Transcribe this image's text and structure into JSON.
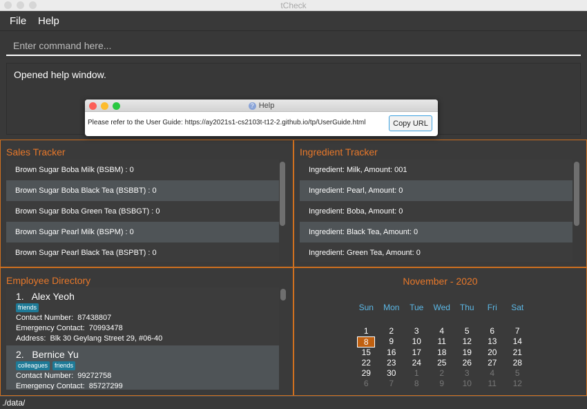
{
  "window": {
    "title": "tCheck"
  },
  "menu": {
    "file": "File",
    "help": "Help"
  },
  "command": {
    "placeholder": "Enter command here...",
    "value": ""
  },
  "result": {
    "text": "Opened help window."
  },
  "help_dialog": {
    "title": "Help",
    "message": "Please refer to the User Guide: https://ay2021s1-cs2103t-t12-2.github.io/tp/UserGuide.html",
    "copy_button": "Copy URL"
  },
  "sales": {
    "title": "Sales Tracker",
    "items": [
      "Brown Sugar Boba Milk (BSBM) : 0",
      "Brown Sugar Boba Black Tea (BSBBT) : 0",
      "Brown Sugar Boba Green Tea (BSBGT) : 0",
      "Brown Sugar Pearl Milk (BSPM) : 0",
      "Brown Sugar Pearl Black Tea (BSPBT) : 0"
    ]
  },
  "ingredients": {
    "title": "Ingredient Tracker",
    "items": [
      "Ingredient: Milk,  Amount: 001",
      "Ingredient: Pearl,  Amount: 0",
      "Ingredient: Boba,  Amount: 0",
      "Ingredient: Black Tea,  Amount: 0",
      "Ingredient: Green Tea,  Amount: 0"
    ]
  },
  "employees": {
    "title": "Employee Directory",
    "items": [
      {
        "index": "1.",
        "name": "Alex Yeoh",
        "tags": [
          "friends"
        ],
        "contact_label": "Contact Number:",
        "contact": "87438807",
        "emergency_label": "Emergency Contact:",
        "emergency": "70993478",
        "address_label": "Address:",
        "address": "Blk 30 Geylang Street 29, #06-40"
      },
      {
        "index": "2.",
        "name": "Bernice Yu",
        "tags": [
          "colleagues",
          "friends"
        ],
        "contact_label": "Contact Number:",
        "contact": "99272758",
        "emergency_label": "Emergency Contact:",
        "emergency": "85727299"
      }
    ]
  },
  "calendar": {
    "title": "November - 2020",
    "weekdays": [
      "Sun",
      "Mon",
      "Tue",
      "Wed",
      "Thu",
      "Fri",
      "Sat"
    ],
    "days": [
      "1",
      "2",
      "3",
      "4",
      "5",
      "6",
      "7",
      "8",
      "9",
      "10",
      "11",
      "12",
      "13",
      "14",
      "15",
      "16",
      "17",
      "18",
      "19",
      "20",
      "21",
      "22",
      "23",
      "24",
      "25",
      "26",
      "27",
      "28",
      "29",
      "30",
      "1",
      "2",
      "3",
      "4",
      "5",
      "6",
      "7",
      "8",
      "9",
      "10",
      "11",
      "12"
    ],
    "current_month_count": 30,
    "selected": "8",
    "accent": "#c06010"
  },
  "status": {
    "path": "./data/"
  },
  "colors": {
    "accent": "#e8782a",
    "border": "#d0701f",
    "tag": "#1e7a97",
    "weekday": "#5cb8e6"
  }
}
